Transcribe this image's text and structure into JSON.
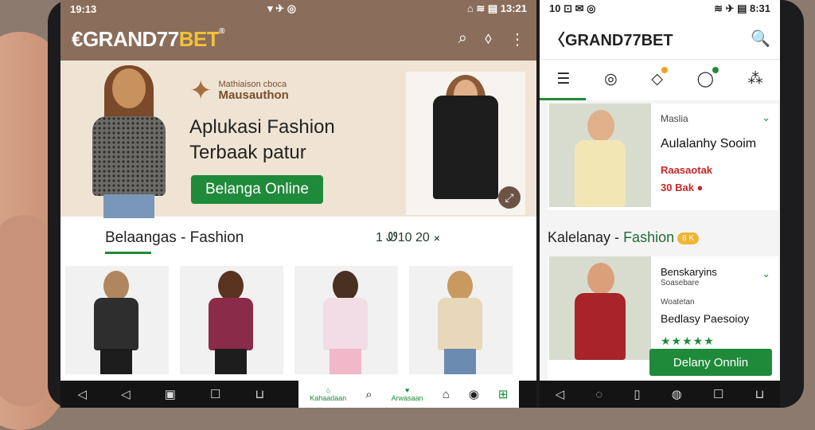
{
  "left": {
    "status": {
      "time": "19:13",
      "icons": "▾ ✈ ◎",
      "right": "⌂ ≋ ▤ 13:21"
    },
    "appbar": {
      "logo_main": "€GRAND77",
      "logo_accent": "BET",
      "logo_reg": "®",
      "icon_search": "⌕",
      "icon_location": "⬨",
      "icon_more": "⋮"
    },
    "hero": {
      "brand_small": "Mathiaison cboca",
      "brand_name": "Mausauthon",
      "headline_1": "Aplukasi Fashion",
      "headline_2": "Terbaak patur",
      "cta": "Belanga Online",
      "expand_icon": "⤢"
    },
    "section": {
      "title": "Belaangas - Fashion",
      "counter": "1 Ꮺ10 20 ⨯"
    },
    "cards": [
      {
        "id": "coat",
        "top": "#2e2e2e",
        "hair": "#b08660",
        "legs": "#1d1d1d"
      },
      {
        "id": "plaid",
        "top": "#8a2b4a",
        "hair": "#5a3320",
        "legs": "#1d1d1d"
      },
      {
        "id": "pink",
        "top": "#f2dce6",
        "hair": "#4a3020",
        "legs": "#f0b8c8"
      },
      {
        "id": "cardigan",
        "top": "#e8d7b8",
        "hair": "#c89a60",
        "legs": "#6b8bb0"
      }
    ],
    "nav": {
      "back1": "◁",
      "back2": "◁",
      "img": "▣",
      "square": "☐",
      "cart": "⊔",
      "home_label": "Kahaadaan",
      "search": "⌕",
      "love_label": "Arwasaan",
      "house": "⌂",
      "bell": "◉",
      "store": "⊞",
      "active_color": "#1f8a3a"
    }
  },
  "right": {
    "status": {
      "left": "10 ⊡ ✉ ◎",
      "right": "≋ ✈ ▤ 8:31"
    },
    "logo": "〈GRAND77BET",
    "logo_icon": "🔍",
    "tabs": [
      "☰",
      "◎",
      "◇",
      "◯",
      "⁂"
    ],
    "product1": {
      "kicker": "Maslia",
      "title": "Aulalanhy Sooim",
      "sale": "Raasaotak",
      "price": "30 Bak",
      "hot_icon": "●",
      "chevron": "⌄",
      "top_color": "#f3e6b5"
    },
    "section": {
      "title": "Kalelanay - ",
      "accent": "Fashion",
      "badge": "8 K"
    },
    "product2": {
      "kicker": "Benskaryins",
      "sub": "Soasebare",
      "line1": "Woatetan",
      "title": "Bedlasy Paesoioy",
      "stars": "★★★★★",
      "cta": "Delany Onnlin",
      "chevron": "⌄",
      "top_color": "#a8232a"
    },
    "nav": {
      "a": "◁",
      "b": "◌",
      "c": "▯",
      "d": "◍",
      "e": "☐",
      "f": "⊔"
    }
  }
}
